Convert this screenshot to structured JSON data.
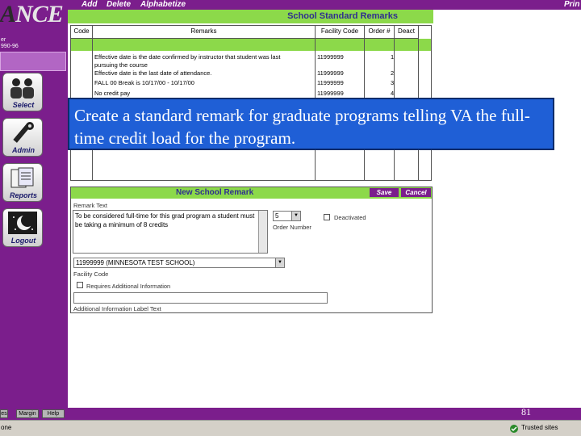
{
  "menu": {
    "add": "Add",
    "delete": "Delete",
    "alphabetize": "Alphabetize",
    "print": "Prin"
  },
  "sidebar": {
    "logo_letter": "A",
    "logo_text": "NCE",
    "line1": "er",
    "line2": "990-96",
    "items": [
      {
        "label": "Select"
      },
      {
        "label": "Admin"
      },
      {
        "label": "Reports"
      },
      {
        "label": "Logout"
      }
    ]
  },
  "remarks_table": {
    "title": "School Standard Remarks",
    "columns": [
      "Code",
      "Remarks",
      "Facility Code",
      "Order #",
      "Deact"
    ],
    "rows": [
      {
        "remark": "Effective date is the date confirmed by instructor that student was last",
        "facility": "11999999",
        "order": "1"
      },
      {
        "remark": "pursuing the course",
        "facility": "",
        "order": ""
      },
      {
        "remark": "Effective date is the last date of attendance.",
        "facility": "11999999",
        "order": "2"
      },
      {
        "remark": "FALL 00 Break is 10/17/00 - 10/17/00",
        "facility": "11999999",
        "order": "3"
      },
      {
        "remark": "No credit pay",
        "facility": "11999999",
        "order": "4"
      }
    ]
  },
  "overlay": {
    "text": "Create a standard remark for graduate programs telling VA the full-time credit load for the program."
  },
  "form": {
    "title": "New School Remark",
    "save_label": "Save",
    "cancel_label": "Cancel",
    "remark_text_label": "Remark Text",
    "remark_text_value": "To be considered full-time for this grad program a student must be taking a minimum of 8 credits",
    "order_value": "5",
    "order_label": "Order Number",
    "deactivated_label": "Deactivated",
    "facility_value": "11999999 (MINNESOTA TEST SCHOOL)",
    "facility_label": "Facility Code",
    "require_info_label": "Requires Additional Information",
    "additional_label_placeholder": "Additional Information Label Text"
  },
  "bottom": {
    "btn_left": "es",
    "margin": "Margin",
    "help": "Help",
    "page_number": "81",
    "status_left": "one",
    "trusted": "Trusted sites"
  }
}
